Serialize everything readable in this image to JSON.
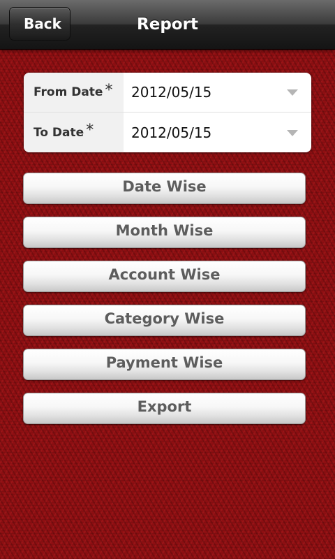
{
  "header": {
    "back_label": "Back",
    "title": "Report"
  },
  "date_filters": {
    "from_label": "From Date",
    "from_value": "2012/05/15",
    "to_label": "To Date",
    "to_value": "2012/05/15",
    "required_marker": "*"
  },
  "report_buttons": {
    "date_wise": "Date Wise",
    "month_wise": "Month Wise",
    "account_wise": "Account Wise",
    "category_wise": "Category Wise",
    "payment_wise": "Payment Wise",
    "export": "Export"
  },
  "icons": {
    "back": "back-arrow-icon",
    "dropdown": "chevron-down-icon"
  },
  "colors": {
    "background": "#8e0f12",
    "titlebar": "#2a2a2a",
    "button_text": "#5d5d5d"
  }
}
